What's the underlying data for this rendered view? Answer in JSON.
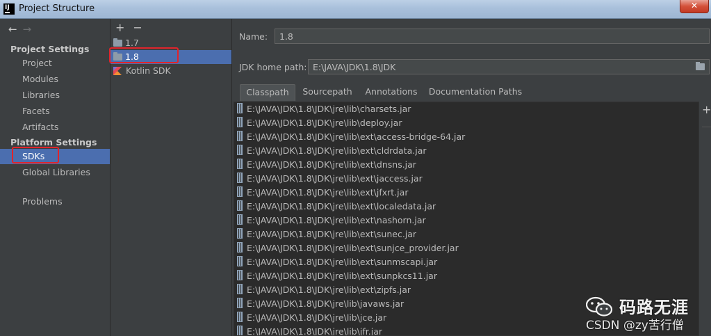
{
  "window": {
    "app_icon": "IJ",
    "title": "Project Structure",
    "close_label": "✕"
  },
  "nav": {
    "back_icon": "←",
    "forward_icon": "→",
    "project_settings_header": "Project Settings",
    "project_settings": [
      "Project",
      "Modules",
      "Libraries",
      "Facets",
      "Artifacts"
    ],
    "platform_settings_header": "Platform Settings",
    "platform_settings": [
      "SDKs",
      "Global Libraries"
    ],
    "problems": "Problems",
    "selected": "SDKs"
  },
  "sdk_panel": {
    "add_icon": "+",
    "remove_icon": "−",
    "items": [
      {
        "label": "1.7",
        "icon": "folder-icon"
      },
      {
        "label": "1.8",
        "icon": "folder-icon"
      },
      {
        "label": "Kotlin SDK",
        "icon": "kotlin-icon"
      }
    ],
    "selected": "1.8"
  },
  "details": {
    "name_label": "Name:",
    "name_value": "1.8",
    "jdk_home_label": "JDK home path:",
    "jdk_home_value": "E:\\JAVA\\JDK\\1.8\\JDK",
    "tabs": [
      "Classpath",
      "Sourcepath",
      "Annotations",
      "Documentation Paths"
    ],
    "active_tab": "Classpath",
    "classpath": [
      "E:\\JAVA\\JDK\\1.8\\JDK\\jre\\lib\\charsets.jar",
      "E:\\JAVA\\JDK\\1.8\\JDK\\jre\\lib\\deploy.jar",
      "E:\\JAVA\\JDK\\1.8\\JDK\\jre\\lib\\ext\\access-bridge-64.jar",
      "E:\\JAVA\\JDK\\1.8\\JDK\\jre\\lib\\ext\\cldrdata.jar",
      "E:\\JAVA\\JDK\\1.8\\JDK\\jre\\lib\\ext\\dnsns.jar",
      "E:\\JAVA\\JDK\\1.8\\JDK\\jre\\lib\\ext\\jaccess.jar",
      "E:\\JAVA\\JDK\\1.8\\JDK\\jre\\lib\\ext\\jfxrt.jar",
      "E:\\JAVA\\JDK\\1.8\\JDK\\jre\\lib\\ext\\localedata.jar",
      "E:\\JAVA\\JDK\\1.8\\JDK\\jre\\lib\\ext\\nashorn.jar",
      "E:\\JAVA\\JDK\\1.8\\JDK\\jre\\lib\\ext\\sunec.jar",
      "E:\\JAVA\\JDK\\1.8\\JDK\\jre\\lib\\ext\\sunjce_provider.jar",
      "E:\\JAVA\\JDK\\1.8\\JDK\\jre\\lib\\ext\\sunmscapi.jar",
      "E:\\JAVA\\JDK\\1.8\\JDK\\jre\\lib\\ext\\sunpkcs11.jar",
      "E:\\JAVA\\JDK\\1.8\\JDK\\jre\\lib\\ext\\zipfs.jar",
      "E:\\JAVA\\JDK\\1.8\\JDK\\jre\\lib\\javaws.jar",
      "E:\\JAVA\\JDK\\1.8\\JDK\\jre\\lib\\jce.jar",
      "E:\\JAVA\\JDK\\1.8\\JDK\\jre\\lib\\jfr.jar"
    ],
    "side_add_icon": "+"
  },
  "watermark": {
    "title": "码路无涯",
    "subtitle": "CSDN @zy苦行僧"
  },
  "colors": {
    "selection": "#4b6eaf",
    "highlight": "#e0242b",
    "background": "#3c3f41",
    "list_background": "#2b2b2b"
  }
}
